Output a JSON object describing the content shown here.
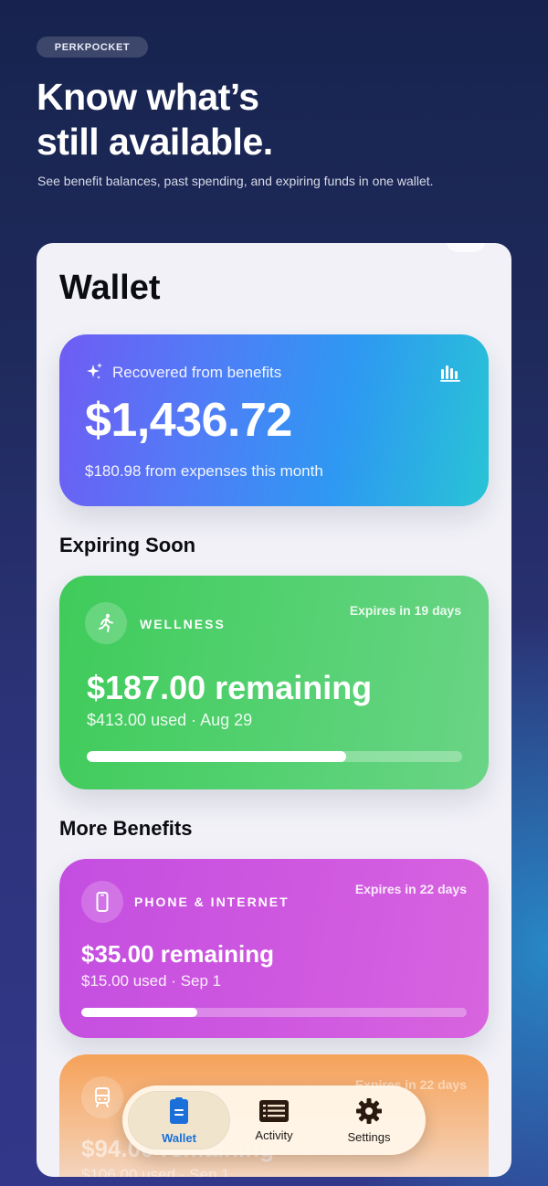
{
  "header": {
    "app_tag": "PERKPOCKET",
    "headline": "Know what’s\nstill available.",
    "subline": "See benefit balances, past spending, and expiring funds in one wallet."
  },
  "wallet": {
    "title": "Wallet",
    "recovered": {
      "label": "Recovered from benefits",
      "amount": "$1,436.72",
      "subtext": "$180.98 from expenses this month",
      "icon": "sparkle-icon",
      "chart_icon": "bar-chart-icon"
    },
    "expiring_title": "Expiring Soon",
    "expiring": [
      {
        "category": "WELLNESS",
        "icon": "running-figure-icon",
        "expires": "Expires in 19 days",
        "remaining": "$187.00 remaining",
        "used": "$413.00 used · Aug 29",
        "progress": 0.69,
        "color": "#4fce68"
      }
    ],
    "more_title": "More Benefits",
    "benefits": [
      {
        "category": "PHONE & INTERNET",
        "icon": "phone-icon",
        "expires": "Expires in 22 days",
        "remaining": "$35.00 remaining",
        "used": "$15.00 used · Sep 1",
        "progress": 0.3,
        "color": "#cd56e0"
      },
      {
        "category": "",
        "icon": "train-icon",
        "expires": "Expires in 22 days",
        "remaining": "$94.00 remaining",
        "used": "$106.00 used · Sep 1",
        "color": "#f6a25a"
      }
    ]
  },
  "tabbar": {
    "tabs": [
      {
        "label": "Wallet",
        "icon": "wallet-card-icon",
        "active": true,
        "color": "#1a6fd8"
      },
      {
        "label": "Activity",
        "icon": "list-icon",
        "active": false
      },
      {
        "label": "Settings",
        "icon": "gear-icon",
        "active": false
      }
    ]
  }
}
